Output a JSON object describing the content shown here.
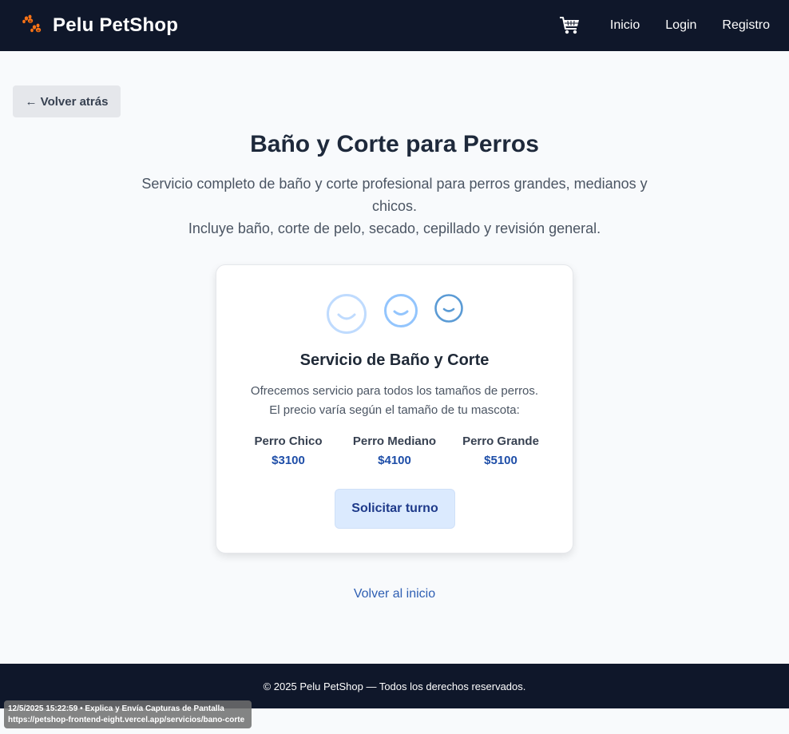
{
  "navbar": {
    "brand": "Pelu PetShop",
    "links": [
      "Inicio",
      "Login",
      "Registro"
    ],
    "icons": {
      "logo": "paw-icon",
      "cart": "cart-icon"
    }
  },
  "back_button": "← Volver atrás",
  "page": {
    "title": "Baño y Corte para Perros",
    "description_line1": "Servicio completo de baño y corte profesional para perros grandes, medianos y chicos.",
    "description_line2": "Incluye baño, corte de pelo, secado, cepillado y revisión general."
  },
  "card": {
    "icons": [
      "smile-face-icon",
      "smile-face-icon",
      "smile-face-icon"
    ],
    "title": "Servicio de Baño y Corte",
    "desc_line1": "Ofrecemos servicio para todos los tamaños de perros.",
    "desc_line2": "El precio varía según el tamaño de tu mascota:",
    "prices": [
      {
        "name": "Perro Chico",
        "value": "$3100"
      },
      {
        "name": "Perro Mediano",
        "value": "$4100"
      },
      {
        "name": "Perro Grande",
        "value": "$5100"
      }
    ],
    "button": "Solicitar turno"
  },
  "home_link": "Volver al inicio",
  "footer": "© 2025 Pelu PetShop — Todos los derechos reservados.",
  "overlay": {
    "line1": "12/5/2025 15:22:59 • Explica y Envía Capturas de Pantalla",
    "line2": "https://petshop-frontend-eight.vercel.app/servicios/bano-corte"
  },
  "colors": {
    "nav_bg": "#0f172a",
    "accent": "#1e4ea8",
    "button_bg": "#dbeafe",
    "paw": "#f97316"
  }
}
